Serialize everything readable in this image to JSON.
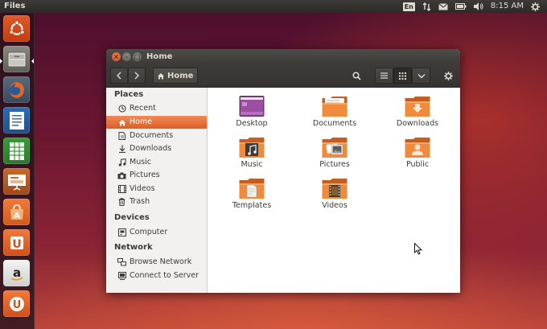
{
  "top_panel": {
    "app_title": "Files",
    "keyboard_layout": "En",
    "clock": "8:15 AM"
  },
  "launcher": {
    "items": [
      {
        "name": "ubuntu-dash",
        "icon": "ubuntu-logo-icon"
      },
      {
        "name": "files",
        "icon": "file-cabinet-icon",
        "running": true,
        "active": true
      },
      {
        "name": "firefox",
        "icon": "firefox-icon"
      },
      {
        "name": "libreoffice-writer",
        "icon": "writer-icon"
      },
      {
        "name": "libreoffice-calc",
        "icon": "calc-icon"
      },
      {
        "name": "libreoffice-impress",
        "icon": "impress-icon"
      },
      {
        "name": "software-center",
        "icon": "software-center-icon"
      },
      {
        "name": "ubuntu-one",
        "icon": "ubuntu-one-icon"
      },
      {
        "name": "amazon",
        "icon": "amazon-icon"
      },
      {
        "name": "ubuntu-one-music",
        "icon": "ubuntu-one-music-icon"
      }
    ]
  },
  "window": {
    "title": "Home",
    "path_button": "Home",
    "sidebar": {
      "places_header": "Places",
      "places": [
        {
          "label": "Recent",
          "icon": "clock-icon"
        },
        {
          "label": "Home",
          "icon": "home-icon",
          "active": true
        },
        {
          "label": "Documents",
          "icon": "document-icon"
        },
        {
          "label": "Downloads",
          "icon": "download-icon"
        },
        {
          "label": "Music",
          "icon": "music-note-icon"
        },
        {
          "label": "Pictures",
          "icon": "camera-icon"
        },
        {
          "label": "Videos",
          "icon": "film-icon"
        },
        {
          "label": "Trash",
          "icon": "trash-icon"
        }
      ],
      "devices_header": "Devices",
      "devices": [
        {
          "label": "Computer",
          "icon": "computer-icon"
        }
      ],
      "network_header": "Network",
      "network": [
        {
          "label": "Browse Network",
          "icon": "network-icon"
        },
        {
          "label": "Connect to Server",
          "icon": "server-icon"
        }
      ]
    },
    "files": [
      {
        "label": "Desktop",
        "icon": "desktop-folder-icon"
      },
      {
        "label": "Documents",
        "icon": "documents-folder-icon"
      },
      {
        "label": "Downloads",
        "icon": "downloads-folder-icon"
      },
      {
        "label": "Music",
        "icon": "music-folder-icon"
      },
      {
        "label": "Pictures",
        "icon": "pictures-folder-icon"
      },
      {
        "label": "Public",
        "icon": "public-folder-icon"
      },
      {
        "label": "Templates",
        "icon": "templates-folder-icon"
      },
      {
        "label": "Videos",
        "icon": "videos-folder-icon"
      }
    ]
  },
  "colors": {
    "accent": "#dd4814",
    "folder": "#f08a3c",
    "panel": "#3c3b37",
    "sidebar_active": "#e8652e"
  }
}
